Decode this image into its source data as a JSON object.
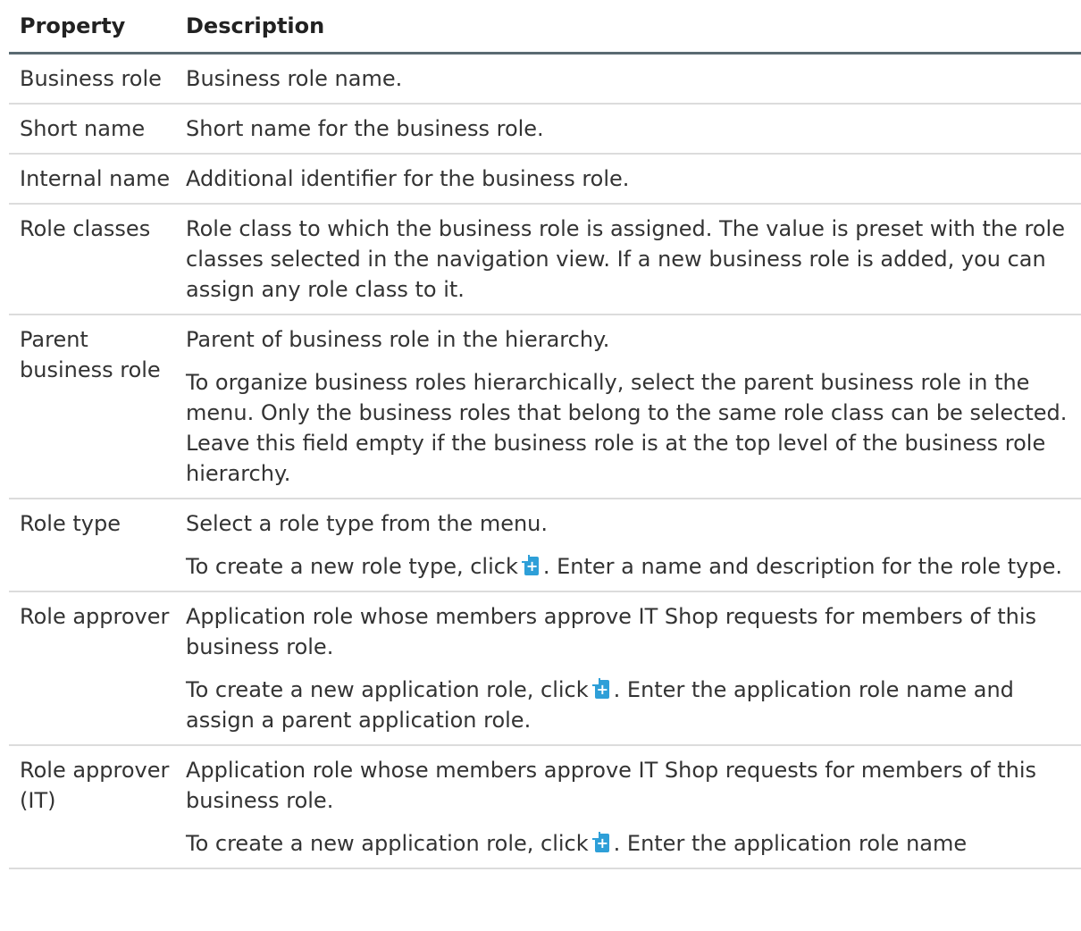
{
  "header": {
    "property": "Property",
    "description": "Description"
  },
  "rows": [
    {
      "property": "Business role",
      "description": [
        "Business role name."
      ]
    },
    {
      "property": "Short name",
      "description": [
        "Short name for the business role."
      ]
    },
    {
      "property": "Internal name",
      "description": [
        "Additional identifier for the business role."
      ]
    },
    {
      "property": "Role classes",
      "description": [
        "Role class to which the business role is assigned. The value is preset with the role classes selected in the navigation view. If a new business role is added, you can assign any role class to it."
      ]
    },
    {
      "property": "Parent business role",
      "description": [
        "Parent of business role in the hierarchy.",
        "To organize business roles hierarchically, select the parent business role in the menu. Only the business roles that belong to the same role class can be selected. Leave this field empty if the business role is at the top level of the business role hierarchy."
      ]
    },
    {
      "property": "Role type",
      "description": [
        "Select a role type from the menu."
      ],
      "create": {
        "before": "To create a new role type, click",
        "after": ". Enter a name and description for the role type."
      }
    },
    {
      "property": "Role approver",
      "description": [
        "Application role whose members approve IT Shop requests for members of this business role."
      ],
      "create": {
        "before": "To create a new application role, click",
        "after": ". Enter the application role name and assign a parent application role."
      }
    },
    {
      "property": "Role approver (IT)",
      "description": [
        "Application role whose members approve IT Shop requests for members of this business role."
      ],
      "create": {
        "before": "To create a new application role, click",
        "after": ". Enter the application role name"
      }
    }
  ],
  "icons": {
    "create": "add-new-icon"
  },
  "colors": {
    "icon": "#2e9fd8",
    "header_rule": "#5a6a72",
    "row_rule": "#dcdcdc"
  }
}
